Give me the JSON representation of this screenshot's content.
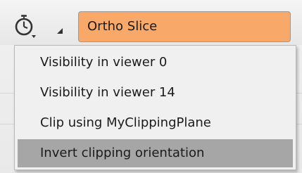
{
  "toolbar": {
    "timer_icon": "stopwatch-icon",
    "collapse_icon": "triangle-collapse-icon",
    "node_name": "Ortho Slice",
    "node_color": "#f8a868"
  },
  "menu": {
    "items": [
      {
        "label": "Visibility in viewer 0"
      },
      {
        "label": "Visibility in viewer 14"
      },
      {
        "label": "Clip using MyClippingPlane"
      },
      {
        "label": "Invert clipping orientation",
        "highlighted": true
      }
    ],
    "highlight_color": "#a6a6a6"
  }
}
